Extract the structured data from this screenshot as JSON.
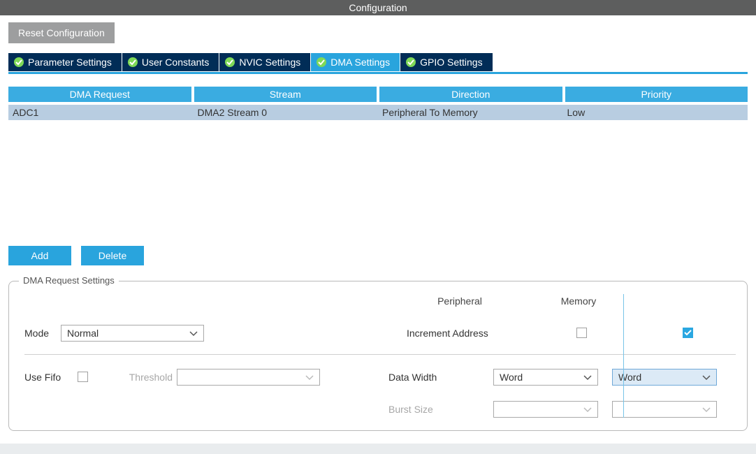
{
  "title": "Configuration",
  "reset_button": "Reset Configuration",
  "tabs": [
    {
      "label": "Parameter Settings",
      "active": false
    },
    {
      "label": "User Constants",
      "active": false
    },
    {
      "label": "NVIC Settings",
      "active": false
    },
    {
      "label": "DMA Settings",
      "active": true
    },
    {
      "label": "GPIO Settings",
      "active": false
    }
  ],
  "table": {
    "headers": [
      "DMA Request",
      "Stream",
      "Direction",
      "Priority"
    ],
    "rows": [
      {
        "request": "ADC1",
        "stream": "DMA2 Stream 0",
        "direction": "Peripheral To Memory",
        "priority": "Low"
      }
    ]
  },
  "buttons": {
    "add": "Add",
    "delete": "Delete"
  },
  "settings": {
    "legend": "DMA Request Settings",
    "col_peripheral": "Peripheral",
    "col_memory": "Memory",
    "mode_label": "Mode",
    "mode_value": "Normal",
    "increment_label": "Increment Address",
    "increment_peripheral_checked": false,
    "increment_memory_checked": true,
    "use_fifo_label": "Use Fifo",
    "use_fifo_checked": false,
    "threshold_label": "Threshold",
    "threshold_value": "",
    "data_width_label": "Data Width",
    "data_width_peripheral": "Word",
    "data_width_memory": "Word",
    "burst_size_label": "Burst Size",
    "burst_size_peripheral": "",
    "burst_size_memory": ""
  }
}
